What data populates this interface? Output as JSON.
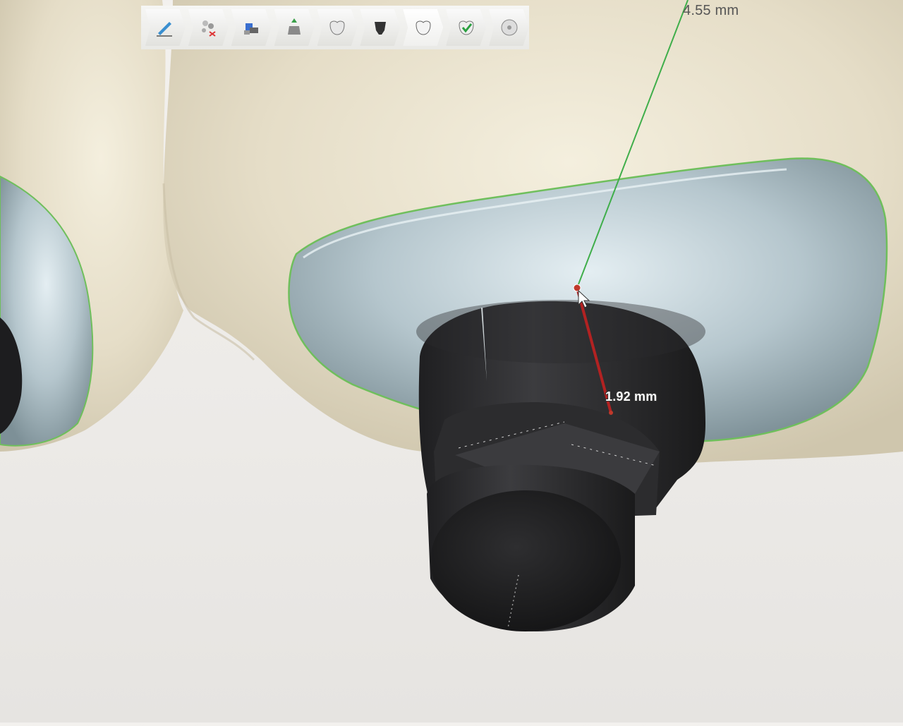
{
  "toolbar": {
    "tools": [
      {
        "icon": "sketch-pencil-icon"
      },
      {
        "icon": "scatter-tools-icon"
      },
      {
        "icon": "implant-parts-icon"
      },
      {
        "icon": "abutment-insert-icon"
      },
      {
        "icon": "crown-icon"
      },
      {
        "icon": "abutment-dark-icon"
      },
      {
        "icon": "crown-outline-icon",
        "active": true
      },
      {
        "icon": "crown-check-icon"
      },
      {
        "icon": "disc-export-icon"
      }
    ]
  },
  "measurements": {
    "green_distance": "4.55 mm",
    "red_distance": "1.92 mm"
  },
  "colors": {
    "tooth": "#e6dfcb",
    "crown_cap": "#b9c9cf",
    "abutment": "#3a3a3c",
    "margin_line": "#6fbf5c",
    "measure_green": "#3fae4a",
    "measure_red": "#b22222"
  }
}
